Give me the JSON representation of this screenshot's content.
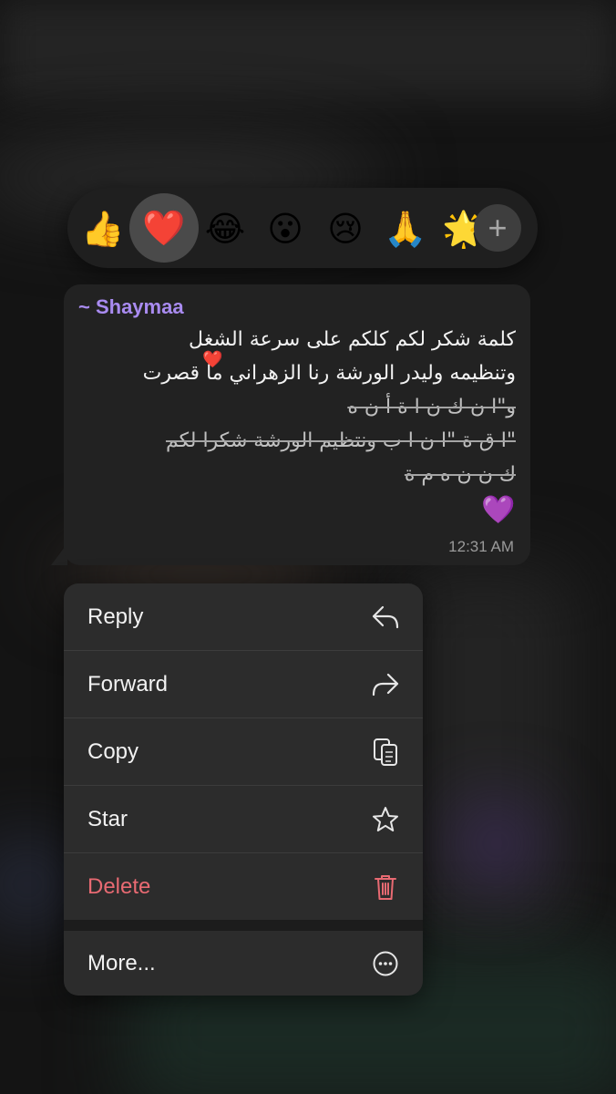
{
  "reactions": {
    "emojis": [
      "👍",
      "❤️",
      "😂",
      "😮",
      "😢",
      "🙏",
      "🌟"
    ],
    "selected_index": 1,
    "add_label": "+"
  },
  "message": {
    "sender": "~ Shaymaa",
    "lines": [
      "كلمة شكر لكم كلكم على سرعة الشغل",
      "وتنظيمه وليدر الورشة رنا الزهراني ما قصرت",
      "و\"ا    ن  ك  ن ا    ة أ          ن         ه",
      "\"ا ق  ة  \"ا  ن ا   ب    ونتظيم الورشة شكرا لكم",
      "ك    ن            ن                 ه  م  ة"
    ],
    "inline_heart": "❤️",
    "end_emoji": "💜",
    "time": "12:31 AM"
  },
  "menu": {
    "items": [
      {
        "label": "Reply",
        "icon": "reply-icon"
      },
      {
        "label": "Forward",
        "icon": "forward-icon"
      },
      {
        "label": "Copy",
        "icon": "copy-icon"
      },
      {
        "label": "Star",
        "icon": "star-icon"
      },
      {
        "label": "Delete",
        "icon": "trash-icon"
      },
      {
        "label": "More...",
        "icon": "more-icon"
      }
    ],
    "delete_color": "#e86a72"
  },
  "colors": {
    "sender": "#a98bf0",
    "accent_heart": "#e8303a",
    "purple_heart": "#9b4fe0"
  }
}
